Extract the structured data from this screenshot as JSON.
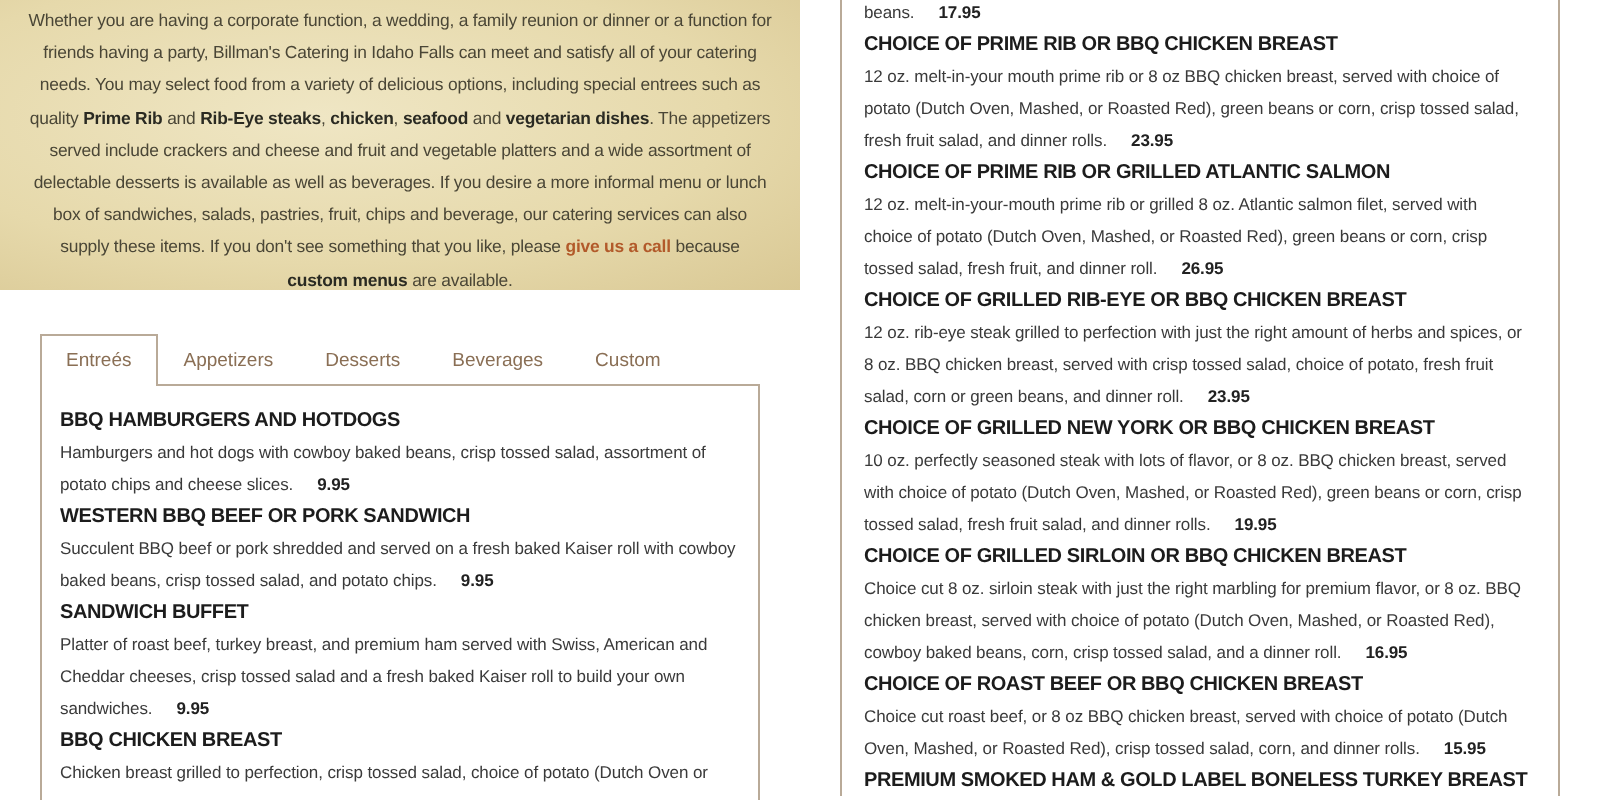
{
  "intro": {
    "segments": [
      {
        "kind": "plain",
        "text": "Whether you are having a corporate function, a wedding, a family reunion or dinner or a function for friends having a party, Billman's Catering in Idaho Falls can meet and satisfy all of your catering needs. You may select food from a variety of delicious options, including special entrees such as quality "
      },
      {
        "kind": "bold",
        "text": "Prime Rib"
      },
      {
        "kind": "plain",
        "text": " and "
      },
      {
        "kind": "bold",
        "text": "Rib-Eye steaks"
      },
      {
        "kind": "plain",
        "text": ", "
      },
      {
        "kind": "bold",
        "text": "chicken"
      },
      {
        "kind": "plain",
        "text": ", "
      },
      {
        "kind": "bold",
        "text": "seafood"
      },
      {
        "kind": "plain",
        "text": " and "
      },
      {
        "kind": "bold",
        "text": "vegetarian dishes"
      },
      {
        "kind": "plain",
        "text": ". The appetizers served include crackers and cheese and fruit and vegetable platters and a wide assortment of delectable desserts is available as well as beverages. If you desire a more informal menu or lunch box of sandwiches, salads, pastries, fruit, chips and beverage, our catering services can also supply these items. If you don't see something that you like, please "
      },
      {
        "kind": "link",
        "text": "give us a call"
      },
      {
        "kind": "plain",
        "text": " because "
      },
      {
        "kind": "bold",
        "text": "custom menus"
      },
      {
        "kind": "plain",
        "text": " are available."
      }
    ]
  },
  "tabs": [
    {
      "label": "Entreés",
      "selected": true
    },
    {
      "label": "Appetizers",
      "selected": false
    },
    {
      "label": "Desserts",
      "selected": false
    },
    {
      "label": "Beverages",
      "selected": false
    },
    {
      "label": "Custom",
      "selected": false
    }
  ],
  "left_items": [
    {
      "title": "BBQ HAMBURGERS AND HOTDOGS",
      "description": "Hamburgers and hot dogs with cowboy baked beans, crisp tossed salad, assortment of potato chips and cheese slices.",
      "price": "9.95"
    },
    {
      "title": "WESTERN BBQ BEEF OR PORK SANDWICH",
      "description": "Succulent BBQ beef or pork shredded and served on a fresh baked Kaiser roll with cowboy baked beans, crisp tossed salad, and potato chips.",
      "price": "9.95"
    },
    {
      "title": "SANDWICH BUFFET",
      "description": "Platter of roast beef, turkey breast, and premium ham served with Swiss, American and Cheddar cheeses, crisp tossed salad and a fresh baked Kaiser roll to build your own sandwiches.",
      "price": "9.95"
    },
    {
      "title": "BBQ CHICKEN BREAST",
      "description": "Chicken breast grilled to perfection, crisp tossed salad, choice of potato (Dutch Oven or"
    }
  ],
  "right_items": [
    {
      "description": "beans.",
      "price": "17.95"
    },
    {
      "title": "CHOICE OF PRIME RIB OR BBQ CHICKEN BREAST",
      "description": "12 oz. melt-in-your mouth prime rib or 8 oz BBQ chicken breast, served with choice of potato (Dutch Oven, Mashed, or Roasted Red), green beans or corn, crisp tossed salad, fresh fruit salad, and dinner rolls.",
      "price": "23.95"
    },
    {
      "title": "CHOICE OF PRIME RIB OR GRILLED ATLANTIC SALMON",
      "description": "12 oz. melt-in-your-mouth prime rib or grilled 8 oz. Atlantic salmon filet, served with choice of potato (Dutch Oven, Mashed, or Roasted Red), green beans or corn, crisp tossed salad, fresh fruit, and dinner roll.",
      "price": "26.95"
    },
    {
      "title": "CHOICE OF GRILLED RIB-EYE OR BBQ CHICKEN BREAST",
      "description": "12 oz. rib-eye steak grilled to perfection with just the right amount of herbs and spices, or 8 oz. BBQ chicken breast, served with crisp tossed salad, choice of potato, fresh fruit salad, corn or green beans, and dinner roll.",
      "price": "23.95"
    },
    {
      "title": "CHOICE OF GRILLED NEW YORK OR BBQ CHICKEN BREAST",
      "description": "10 oz. perfectly seasoned steak with lots of flavor, or 8 oz. BBQ chicken breast, served with choice of potato (Dutch Oven, Mashed, or Roasted Red), green beans or corn, crisp tossed salad, fresh fruit salad, and dinner rolls.",
      "price": "19.95"
    },
    {
      "title": "CHOICE OF GRILLED SIRLOIN OR BBQ CHICKEN BREAST",
      "description": "Choice cut 8 oz. sirloin steak with just the right marbling for premium flavor, or 8 oz. BBQ chicken breast, served with choice of potato (Dutch Oven, Mashed, or Roasted Red), cowboy baked beans, corn, crisp tossed salad, and a dinner roll.",
      "price": "16.95"
    },
    {
      "title": "CHOICE OF ROAST BEEF OR BBQ CHICKEN BREAST",
      "description": "Choice cut roast beef, or 8 oz BBQ chicken breast, served with choice of potato (Dutch Oven, Mashed, or Roasted Red), crisp tossed salad, corn, and dinner rolls.",
      "price": "15.95"
    },
    {
      "title": "PREMIUM SMOKED HAM & GOLD LABEL BONELESS TURKEY BREAST"
    }
  ]
}
